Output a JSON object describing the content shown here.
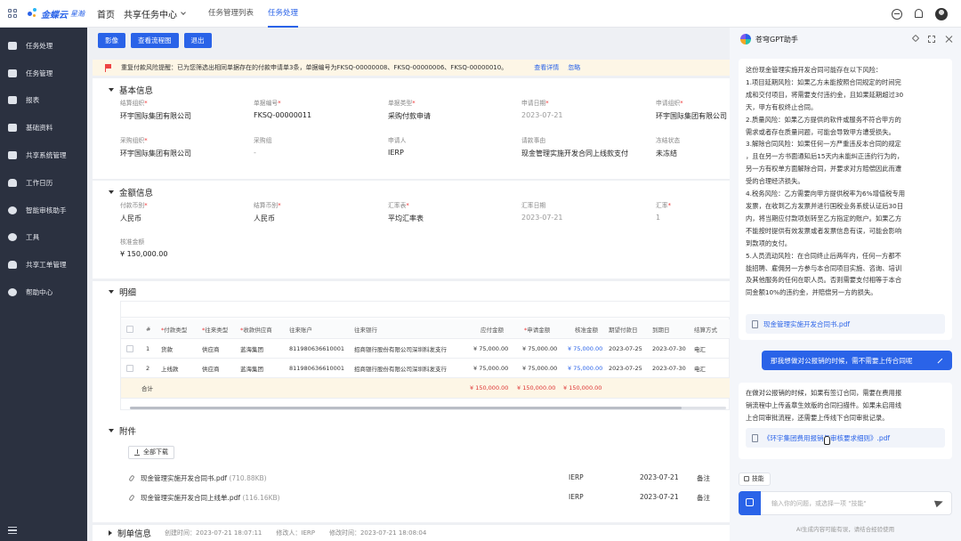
{
  "header": {
    "logo_text": "金蝶云",
    "logo_sub": "星瀚",
    "home": "首页",
    "center": "共享任务中心",
    "tabs": [
      {
        "label": "任务管理列表",
        "active": false
      },
      {
        "label": "任务处理",
        "active": true
      }
    ]
  },
  "sidebar": {
    "items": [
      {
        "label": "任务处理",
        "icon": "task-icon"
      },
      {
        "label": "任务管理",
        "icon": "task-manage-icon"
      },
      {
        "label": "报表",
        "icon": "report-icon"
      },
      {
        "label": "基础资料",
        "icon": "layers-icon"
      },
      {
        "label": "共享系统管理",
        "icon": "settings-list-icon"
      },
      {
        "label": "工作日历",
        "icon": "people-icon"
      },
      {
        "label": "智能审核助手",
        "icon": "robot-icon"
      },
      {
        "label": "工具",
        "icon": "gear-icon"
      },
      {
        "label": "共享工单管理",
        "icon": "people-icon"
      },
      {
        "label": "帮助中心",
        "icon": "help-icon"
      }
    ]
  },
  "actions": {
    "image": "影像",
    "flow": "查看流程图",
    "exit": "退出"
  },
  "notice": {
    "text": "重复付款风险提醒：已为您筛选出相同单据存在的付款申请单3条，单据编号为FKSQ-00000008、FKSQ-00000006、FKSQ-00000010。",
    "detail": "查看详情",
    "ignore": "忽略"
  },
  "basic": {
    "title": "基本信息",
    "row1": [
      {
        "label": "结算组织",
        "req": true,
        "value": "环宇国际集团有限公司"
      },
      {
        "label": "单据编号",
        "req": true,
        "value": "FKSQ-00000011"
      },
      {
        "label": "单据类型",
        "req": true,
        "value": "采购付款申请"
      },
      {
        "label": "申请日期",
        "req": true,
        "value": "2023-07-21"
      },
      {
        "label": "申请组织",
        "req": true,
        "value": "环宇国际集团有限公司"
      }
    ],
    "row2": [
      {
        "label": "采购组织",
        "req": true,
        "value": "环宇国际集团有限公司"
      },
      {
        "label": "采购组",
        "req": false,
        "value": "-"
      },
      {
        "label": "申请人",
        "req": false,
        "value": "IERP"
      },
      {
        "label": "请款事由",
        "req": false,
        "value": "现金管理实施开发合同上线款支付"
      },
      {
        "label": "冻结状态",
        "req": false,
        "value": "未冻结"
      }
    ]
  },
  "amount": {
    "title": "金额信息",
    "row1": [
      {
        "label": "付款币别",
        "req": true,
        "value": "人民币"
      },
      {
        "label": "结算币别",
        "req": true,
        "value": "人民币"
      },
      {
        "label": "汇率表",
        "req": true,
        "value": "平均汇率表"
      },
      {
        "label": "汇率日期",
        "req": false,
        "value": "2023-07-21"
      },
      {
        "label": "汇率",
        "req": true,
        "value": "1"
      }
    ],
    "total_label": "核准金额",
    "total_value": "¥ 150,000.00"
  },
  "detail": {
    "title": "明细",
    "headers": [
      "#",
      "付款类型",
      "往来类型",
      "收款供应商",
      "往来账户",
      "往来银行",
      "应付金额",
      "申请金额",
      "核准金额",
      "期望付款日",
      "到期日",
      "结算方式"
    ],
    "rows": [
      [
        "1",
        "货款",
        "供应商",
        "蓝海集团",
        "811980636610001",
        "招商银行股份有限公司深圳科发支行",
        "¥ 75,000.00",
        "¥ 75,000.00",
        "¥ 75,000.00",
        "2023-07-25",
        "2023-07-30",
        "电汇"
      ],
      [
        "2",
        "上线款",
        "供应商",
        "蓝海集团",
        "811980636610001",
        "招商银行股份有限公司深圳科发支行",
        "¥ 75,000.00",
        "¥ 75,000.00",
        "¥ 75,000.00",
        "2023-07-25",
        "2023-07-30",
        "电汇"
      ]
    ],
    "total": {
      "label": "合计",
      "payable": "¥ 150,000.00",
      "apply": "¥ 150,000.00",
      "approved": "¥ 150,000.00"
    }
  },
  "attachments": {
    "title": "附件",
    "download_all": "全部下载",
    "files": [
      {
        "name": "现金管理实施开发合同书.pdf",
        "size": "(710.88KB)",
        "user": "IERP",
        "date": "2023-07-21",
        "note": "备注"
      },
      {
        "name": "现金管理实施开发合同上线单.pdf",
        "size": "(116.16KB)",
        "user": "IERP",
        "date": "2023-07-21",
        "note": "备注"
      }
    ]
  },
  "footer": {
    "title": "制单信息",
    "created": "创建时间：2023-07-21 18:07:11",
    "modifier": "修改人：IERP",
    "modified": "修改时间：2023-07-21 18:08:04"
  },
  "gpt": {
    "title": "苍穹GPT助手",
    "answer1": [
      "这份现金管理实施开发合同可能存在以下风险：",
      "1.项目延期风险：如果乙方未能按照合同规定的时间完",
      "成和交付项目，将需要支付违约金，且如果延期超过30",
      "天，甲方有权终止合同。",
      "2.质量风险：如果乙方提供的软件或服务不符合甲方的",
      "需求或者存在质量问题，可能会导致甲方遭受损失。",
      "3.解除合同风险：如果任何一方严重违反本合同的规定",
      "，且在另一方书面通知后15天内未能纠正违约行为的，",
      "另一方有权单方面解除合同，并要求对方赔偿因此而遭",
      "受的合理经济损失。",
      "4.税务风险：乙方需要向甲方提供税率为6%增值税专用",
      "发票，在收到乙方发票并进行国税业务系统认证后30日",
      "内，将当期应付款项划转至乙方指定的账户。如果乙方",
      "不能按时提供有效发票或者发票信息有误，可能会影响",
      "到款项的支付。",
      "5.人员流动风险：在合同终止后两年内，任何一方都不",
      "能招聘、雇佣另一方参与本合同项目实施、咨询、培训",
      "及其他服务的任何在职人员。否则需要支付相等于本合",
      "同金额10%的违约金，并赔偿另一方的损失。"
    ],
    "file1": "现金管理实施开发合同书.pdf",
    "question": "那我想做对公报销的时候，需不需要上传合同呢",
    "answer2": [
      "在做对公报销的时候，如果有签订合同，需要在费用报",
      "销流程中上传盖章生效版的合同扫描件。如果未启用线",
      "上合同审批流程，还需要上传线下合同审批记录。"
    ],
    "file2": "《环宇集团费用报销与审核要求细则》.pdf",
    "skills": "技能",
    "input_placeholder": "输入你的问题，或选择一项 \"技能\"",
    "disclaimer": "AI生成内容可能有误，请结合经验使用"
  }
}
